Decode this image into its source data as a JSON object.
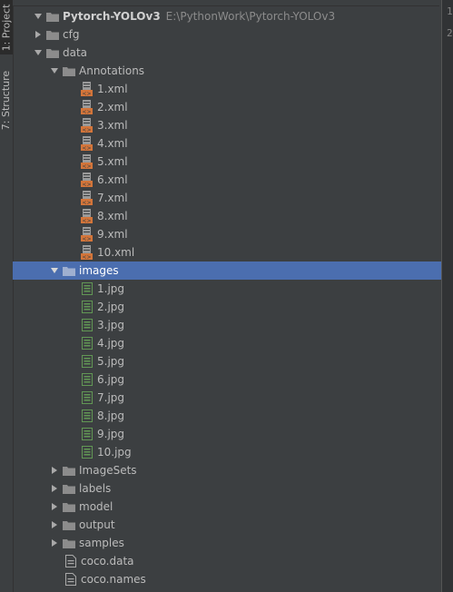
{
  "side_tabs": {
    "project": "1: Project",
    "structure": "7: Structure"
  },
  "line_numbers": [
    "1",
    "2"
  ],
  "tree": {
    "root": {
      "label": "Pytorch-YOLOv3",
      "path": "E:\\PythonWork\\Pytorch-YOLOv3"
    },
    "cfg": "cfg",
    "data": "data",
    "annotations": {
      "label": "Annotations",
      "files": [
        "1.xml",
        "2.xml",
        "3.xml",
        "4.xml",
        "5.xml",
        "6.xml",
        "7.xml",
        "8.xml",
        "9.xml",
        "10.xml"
      ]
    },
    "images": {
      "label": "images",
      "files": [
        "1.jpg",
        "2.jpg",
        "3.jpg",
        "4.jpg",
        "5.jpg",
        "6.jpg",
        "7.jpg",
        "8.jpg",
        "9.jpg",
        "10.jpg"
      ]
    },
    "folders": [
      "ImageSets",
      "labels",
      "model",
      "output",
      "samples"
    ],
    "files": [
      "coco.data",
      "coco.names"
    ]
  },
  "colors": {
    "background": "#3c3f41",
    "selection": "#4b6eaf",
    "folder": "#8c8c8c",
    "xml_icon": "#d3753a",
    "jpg_icon": "#629755"
  }
}
